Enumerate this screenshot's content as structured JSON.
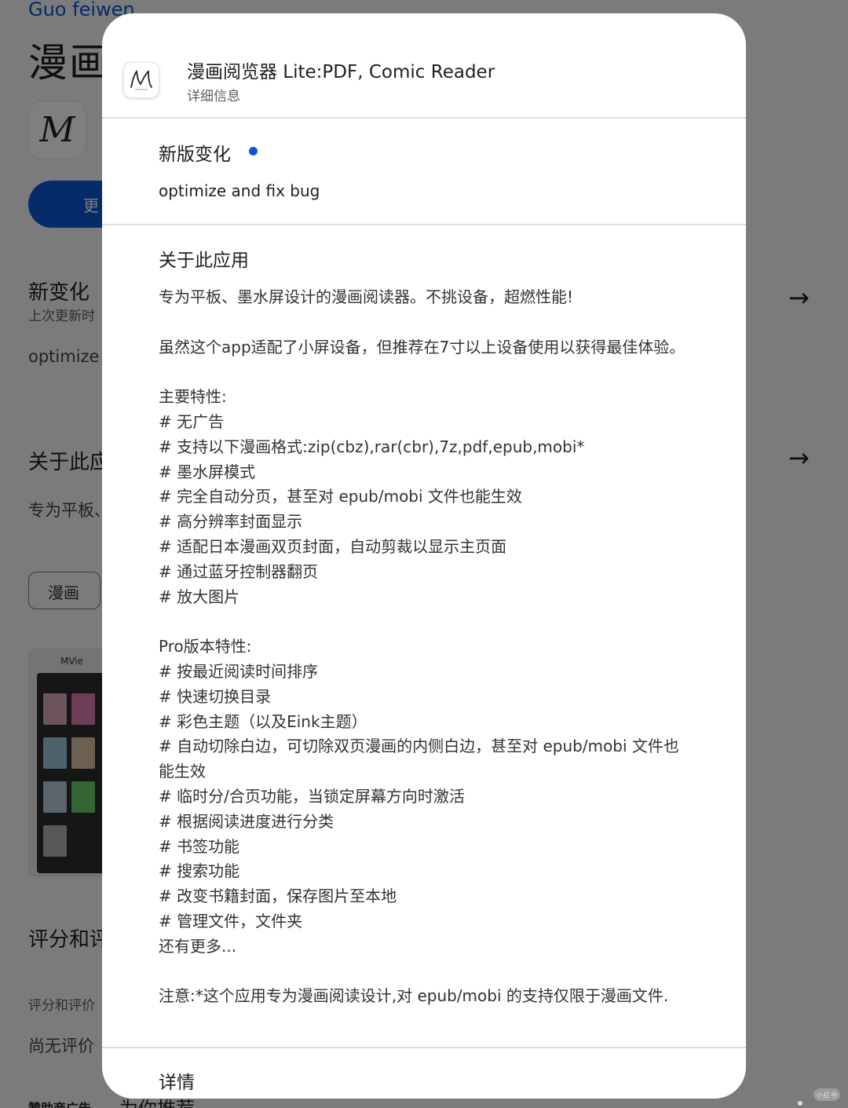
{
  "background": {
    "developer": "Guo feiwen",
    "app_title": "漫画",
    "install_button": "更",
    "whats_new_heading": "新变化",
    "whats_new_sub": "上次更新时",
    "whats_new_text": "optimize a",
    "about_heading": "关于此应",
    "about_text": "专为平板、",
    "category_chip": "漫画",
    "screenshot_title": "MVie",
    "ratings_heading": "评分和评",
    "ratings_sub": "评分和评价",
    "no_ratings": "尚无评价",
    "ads_label": "赞助商广告",
    "recommended": "为你推荐",
    "watermark": "小红书"
  },
  "dialog": {
    "app_name": "漫画阅览器 Lite:PDF, Comic Reader",
    "subtitle": "详细信息",
    "logo_text": "M",
    "whats_new_title": "新版变化",
    "whats_new_body": "optimize and fix bug",
    "about_title": "关于此应用",
    "about_intro": "专为平板、墨水屏设计的漫画阅读器。不挑设备，超燃性能!",
    "about_recommend": "虽然这个app适配了小屏设备，但推荐在7寸以上设备使用以获得最佳体验。",
    "features_heading": "主要特性:",
    "features": [
      "# 无广告",
      "# 支持以下漫画格式:zip(cbz),rar(cbr),7z,pdf,epub,mobi*",
      "# 墨水屏模式",
      "# 完全自动分页，甚至对 epub/mobi 文件也能生效",
      "# 高分辨率封面显示",
      "# 适配日本漫画双页封面，自动剪裁以显示主页面",
      "# 通过蓝牙控制器翻页",
      "# 放大图片"
    ],
    "pro_heading": "Pro版本特性:",
    "pro_features": [
      "# 按最近阅读时间排序",
      "# 快速切换目录",
      "# 彩色主题（以及Eink主题）",
      "# 自动切除白边，可切除双页漫画的内侧白边，甚至对 epub/mobi 文件也能生效",
      "# 临时分/合页功能，当锁定屏幕方向时激活",
      "# 根据阅读进度进行分类",
      "# 书签功能",
      "# 搜索功能",
      "# 改变书籍封面，保存图片至本地",
      "# 管理文件，文件夹"
    ],
    "more": "还有更多...",
    "note": "注意:*这个应用专为漫画阅读设计,对 epub/mobi 的支持仅限于漫画文件.",
    "details_title": "详情"
  },
  "colors": {
    "accent": "#0b57d0",
    "scrim": "rgba(0,0,0,0.5)"
  },
  "icons": [
    "arrow-right-icon",
    "app-logo-icon",
    "new-indicator-dot"
  ]
}
